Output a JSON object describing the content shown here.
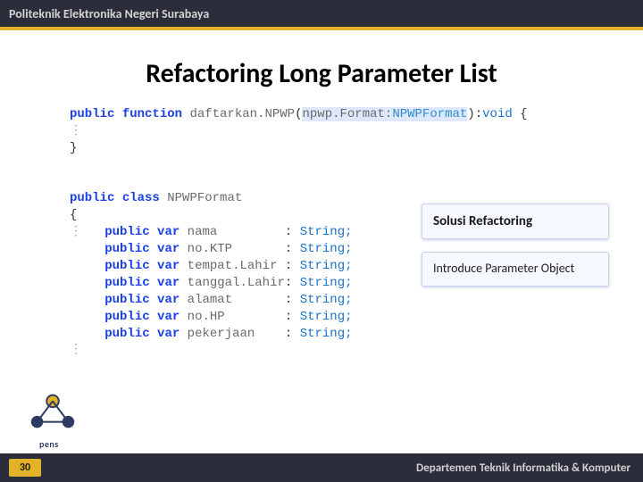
{
  "header": {
    "institution": "Politeknik Elektronika Negeri Surabaya"
  },
  "title": "Refactoring Long Parameter List",
  "code1": {
    "kw_public": "public",
    "kw_function": "function",
    "fn": "daftarkan.NPWP",
    "paren_open": "(",
    "param": "npwp.Format:",
    "ptype": "NPWPFormat",
    "paren_close": "):",
    "ret": "void",
    "brace_open": "{",
    "brace_close": "}"
  },
  "code2": {
    "kw_public": "public",
    "kw_class": "class",
    "cls": "NPWPFormat",
    "brace_open": "{",
    "kw_var": "var",
    "colon": ": ",
    "type": "String;",
    "fields": [
      {
        "name": "nama"
      },
      {
        "name": "no.KTP"
      },
      {
        "name": "tempat.Lahir"
      },
      {
        "name": "tanggal.Lahir"
      },
      {
        "name": "alamat"
      },
      {
        "name": "no.HP"
      },
      {
        "name": "pekerjaan"
      }
    ]
  },
  "callouts": {
    "c1": {
      "title": "Solusi Refactoring"
    },
    "c2": {
      "body": "Introduce Parameter Object"
    }
  },
  "footer": {
    "slide_no": "30",
    "department": "Departemen Teknik Informatika & Komputer"
  },
  "logo": {
    "label": "pens"
  },
  "layout": {
    "field_pad": 13
  }
}
